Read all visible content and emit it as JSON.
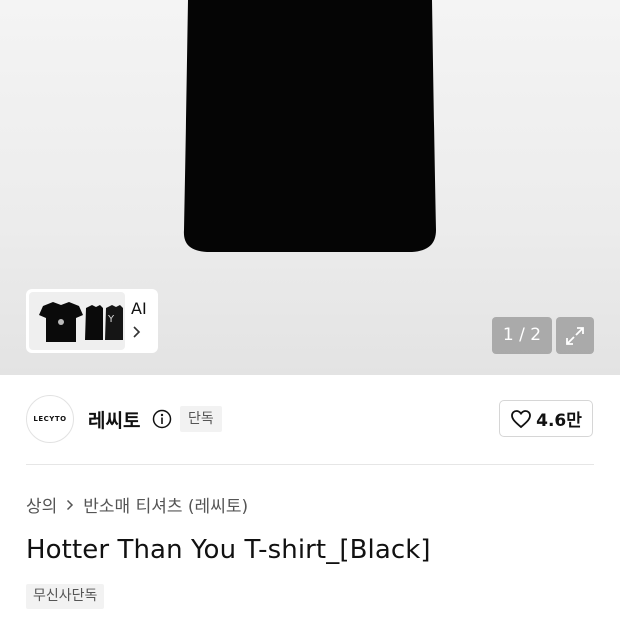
{
  "gallery": {
    "ai_label": "AI",
    "counter": "1 / 2",
    "thumbnail_print": "Y"
  },
  "brand": {
    "logo_text": "LECYTO",
    "name": "레씨토",
    "exclusive_tag": "단독",
    "like_count": "4.6만"
  },
  "breadcrumb": {
    "items": [
      "상의",
      "반소매 티셔츠 (레씨토)"
    ]
  },
  "product": {
    "title": "Hotter Than You T-shirt_[Black]",
    "tag": "무신사단독"
  },
  "icons": {
    "info": "info-icon",
    "like": "heart-icon",
    "expand": "expand-icon",
    "chevron": "chevron-right-icon"
  },
  "colors": {
    "shirt": "#050505",
    "counter_bg": "#969696",
    "tag_bg": "#f2f2f2"
  }
}
